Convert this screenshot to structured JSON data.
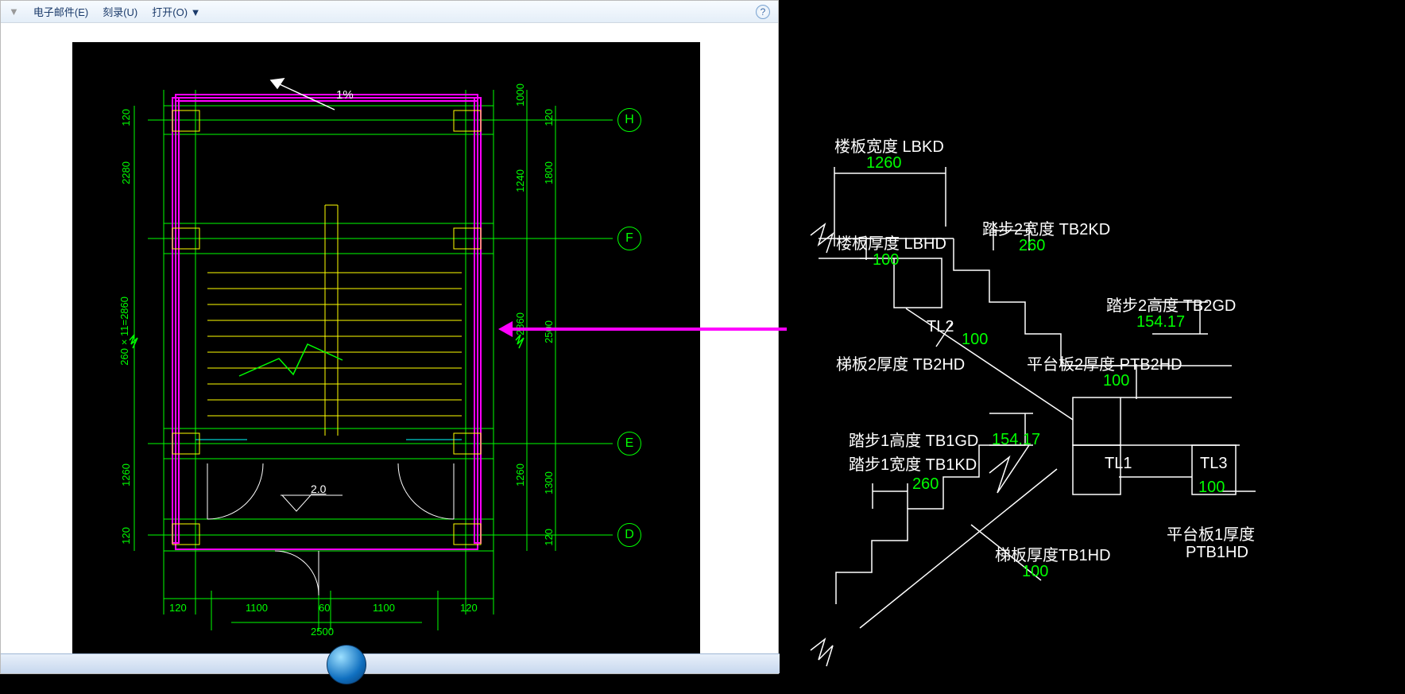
{
  "menu": {
    "email": "电子邮件(E)",
    "record": "刻录(U)",
    "open": "打开(O)",
    "dropdown_glyph": "▼"
  },
  "left_diagram": {
    "slope_text": "1%",
    "level_text": "2.0",
    "grids": [
      "H",
      "F",
      "E",
      "D"
    ],
    "dims_right_inner": [
      "1000",
      "",
      "1240",
      "1800",
      "2860",
      "2500",
      "",
      "1260",
      "1300",
      ""
    ],
    "dims_left": [
      "120",
      "2280",
      "260×11=2860",
      "1260",
      "120"
    ],
    "dims_right_edge": [
      "120",
      "",
      "",
      "",
      "120"
    ],
    "dims_bottom": [
      "120",
      "1100",
      "60",
      "1100",
      "120"
    ],
    "dim_total_bottom": "2500"
  },
  "right_diagram": {
    "lbkd_label": "楼板宽度 LBKD",
    "lbkd_val": "1260",
    "lbhd_label": "楼板厚度 LBHD",
    "lbhd_val": "100",
    "tb2kd_label": "踏步2宽度 TB2KD",
    "tb2kd_val": "260",
    "tb2gd_label": "踏步2高度 TB2GD",
    "tb2gd_val": "154.17",
    "tl2": "TL2",
    "tb2hd_label": "梯板2厚度 TB2HD",
    "tb2hd_val": "100",
    "ptb2hd_label": "平台板2厚度 PTB2HD",
    "ptb2hd_val": "100",
    "tb1gd_label": "踏步1高度 TB1GD",
    "tb1gd_val": "154.17",
    "tb1kd_label": "踏步1宽度 TB1KD",
    "tb1kd_val": "260",
    "tl1": "TL1",
    "tl3": "TL3",
    "tl3_val": "100",
    "tb1hd_label": "梯板厚度TB1HD",
    "tb1hd_val": "100",
    "ptb1hd_label": "平台板1厚度",
    "ptb1hd_code": "PTB1HD"
  }
}
